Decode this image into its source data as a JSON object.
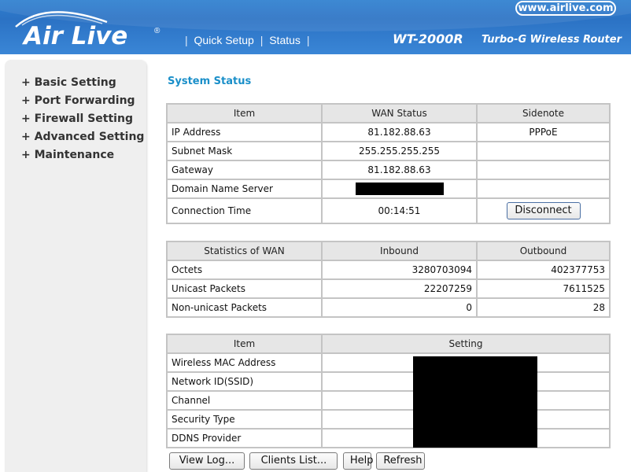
{
  "header": {
    "brand_logo": "Air Live",
    "brand_reg": "®",
    "site": "www.airlive.com",
    "model": "WT-2000R",
    "model_desc": "Turbo-G Wireless Router",
    "nav": {
      "sep": "|",
      "quick_setup": "Quick Setup",
      "status": "Status"
    }
  },
  "sidebar": {
    "items": [
      {
        "label": "+ Basic Setting"
      },
      {
        "label": "+ Port Forwarding"
      },
      {
        "label": "+ Firewall Setting"
      },
      {
        "label": "+ Advanced Setting"
      },
      {
        "label": "+ Maintenance"
      }
    ]
  },
  "page_title": "System Status",
  "wan": {
    "headers": [
      "Item",
      "WAN Status",
      "Sidenote"
    ],
    "rows": [
      {
        "item": "IP Address",
        "value": "81.182.88.63",
        "note": "PPPoE"
      },
      {
        "item": "Subnet Mask",
        "value": "255.255.255.255",
        "note": ""
      },
      {
        "item": "Gateway",
        "value": "81.182.88.63",
        "note": ""
      },
      {
        "item": "Domain Name Server",
        "value": "",
        "note": ""
      },
      {
        "item": "Connection Time",
        "value": "00:14:51",
        "note": ""
      }
    ],
    "disconnect_label": "Disconnect"
  },
  "stats": {
    "headers": [
      "Statistics of WAN",
      "Inbound",
      "Outbound"
    ],
    "rows": [
      {
        "item": "Octets",
        "inbound": "3280703094",
        "outbound": "402377753"
      },
      {
        "item": "Unicast Packets",
        "inbound": "22207259",
        "outbound": "7611525"
      },
      {
        "item": "Non-unicast Packets",
        "inbound": "0",
        "outbound": "28"
      }
    ]
  },
  "wireless": {
    "headers": [
      "Item",
      "Setting"
    ],
    "rows": [
      {
        "item": "Wireless MAC Address"
      },
      {
        "item": "Network ID(SSID)"
      },
      {
        "item": "Channel"
      },
      {
        "item": "Security Type"
      },
      {
        "item": "DDNS Provider"
      }
    ]
  },
  "buttons": {
    "view_log": "View Log...",
    "clients_list": "Clients List...",
    "help": "Help",
    "refresh": "Refresh"
  },
  "colors": {
    "header_blue": "#2b72c4",
    "title_blue": "#1a8fc9",
    "sidebar_bg": "#efefef",
    "table_border": "#c4c4c4",
    "redaction": "#000000"
  }
}
